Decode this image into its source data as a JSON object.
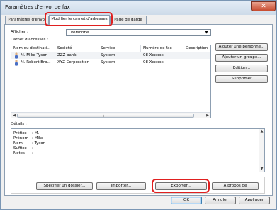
{
  "window": {
    "title": "Paramètres d'envoi de fax",
    "close_symbol": "✕"
  },
  "tabs": [
    {
      "label": "Paramètres d'envoi"
    },
    {
      "label": "Modifier le carnet d'adresses"
    },
    {
      "label": "Page de garde"
    }
  ],
  "filter": {
    "label": "Afficher :",
    "value": "Personne"
  },
  "address_book": {
    "label": "Carnet d'adresses :",
    "columns": [
      "Nom du destinati...",
      "Société",
      "Service",
      "Numéro de fax",
      "Description"
    ],
    "rows": [
      {
        "name": "M. Mike Tyson",
        "company": "ZZZ bank",
        "service": "System",
        "fax": "08 Xxxxxx"
      },
      {
        "name": "M. Robert Bro...",
        "company": "XYZ Corporation",
        "service": "System",
        "fax": "08 Xxxxxx"
      }
    ]
  },
  "side_buttons": {
    "add_person": "Ajouter une personne...",
    "add_group": "Ajouter un groupe...",
    "edit": "Edition...",
    "delete": "Supprimer"
  },
  "details": {
    "label": "Détails :",
    "lines": [
      {
        "key": "Préfixe",
        "value": ": M."
      },
      {
        "key": "Prénom",
        "value": ": Mike"
      },
      {
        "key": "Nom",
        "value": ": Tyson"
      },
      {
        "key": "Suffixe",
        "value": ":"
      },
      {
        "key": "Notes",
        "value": ":"
      }
    ]
  },
  "bottom_buttons": {
    "folder": "Spécifier un dossier...",
    "import": "Importer...",
    "export": "Exporter...",
    "about": "A propos de"
  },
  "dialog_buttons": {
    "ok": "OK",
    "cancel": "Annuler",
    "apply": "Appliquer"
  },
  "colors": {
    "highlight": "#e02020",
    "selection_frame": "#8d9fb2",
    "person_icon": "#4a6fc4"
  }
}
